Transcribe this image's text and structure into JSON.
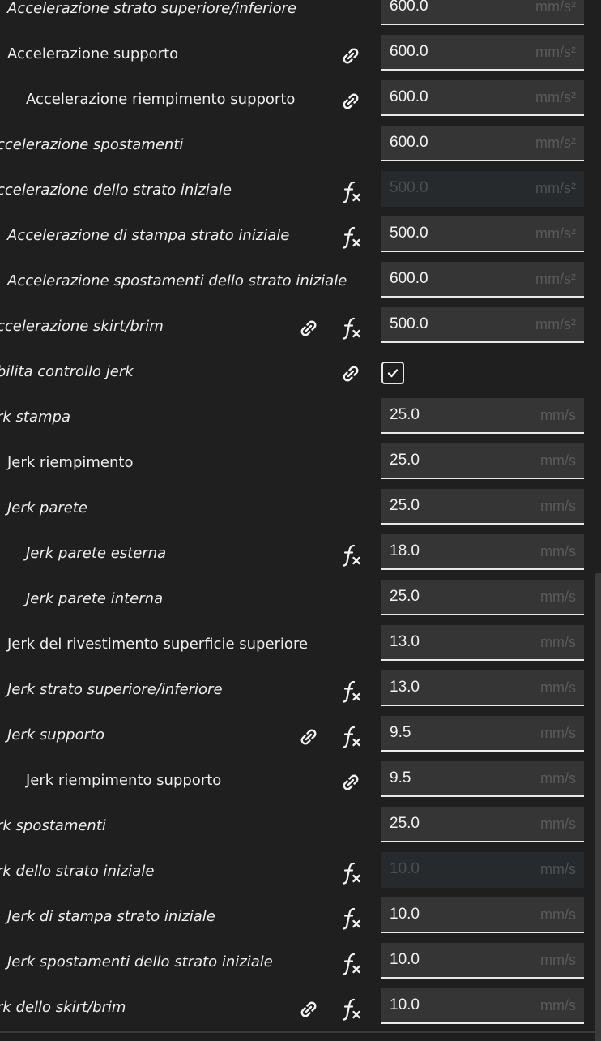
{
  "settings": [
    {
      "label": "Accelerazione strato superiore/inferiore",
      "italic": true,
      "indent": 2,
      "link": false,
      "link_col2": false,
      "fx": false,
      "value": "600.0",
      "unit": "mm/s²",
      "disabled": false
    },
    {
      "label": "Accelerazione supporto",
      "italic": false,
      "indent": 2,
      "link": true,
      "link_col2": false,
      "fx": false,
      "value": "600.0",
      "unit": "mm/s²",
      "disabled": false
    },
    {
      "label": "Accelerazione riempimento supporto",
      "italic": false,
      "indent": 3,
      "link": true,
      "link_col2": false,
      "fx": false,
      "value": "600.0",
      "unit": "mm/s²",
      "disabled": false
    },
    {
      "label": "ccelerazione spostamenti",
      "italic": true,
      "indent": 1,
      "link": false,
      "link_col2": false,
      "fx": false,
      "value": "600.0",
      "unit": "mm/s²",
      "disabled": false
    },
    {
      "label": "ccelerazione dello strato iniziale",
      "italic": true,
      "indent": 1,
      "link": false,
      "link_col2": false,
      "fx": true,
      "value": "500.0",
      "unit": "mm/s²",
      "disabled": true
    },
    {
      "label": "Accelerazione di stampa strato iniziale",
      "italic": true,
      "indent": 2,
      "link": false,
      "link_col2": false,
      "fx": true,
      "value": "500.0",
      "unit": "mm/s²",
      "disabled": false
    },
    {
      "label": "Accelerazione spostamenti dello strato iniziale",
      "italic": true,
      "indent": 2,
      "link": false,
      "link_col2": false,
      "fx": false,
      "value": "600.0",
      "unit": "mm/s²",
      "disabled": false
    },
    {
      "label": "ccelerazione skirt/brim",
      "italic": true,
      "indent": 1,
      "link": false,
      "link_col2": true,
      "fx": true,
      "value": "500.0",
      "unit": "mm/s²",
      "disabled": false
    },
    {
      "label": "bilita controllo jerk",
      "italic": true,
      "indent": 1,
      "link": true,
      "link_col2": false,
      "fx": false,
      "checkbox": true,
      "checked": true
    },
    {
      "label": "rk stampa",
      "italic": true,
      "indent": 1,
      "link": false,
      "link_col2": false,
      "fx": false,
      "value": "25.0",
      "unit": "mm/s",
      "disabled": false
    },
    {
      "label": "Jerk riempimento",
      "italic": false,
      "indent": 2,
      "link": false,
      "link_col2": false,
      "fx": false,
      "value": "25.0",
      "unit": "mm/s",
      "disabled": false
    },
    {
      "label": "Jerk parete",
      "italic": true,
      "indent": 2,
      "link": false,
      "link_col2": false,
      "fx": false,
      "value": "25.0",
      "unit": "mm/s",
      "disabled": false
    },
    {
      "label": "Jerk parete esterna",
      "italic": true,
      "indent": 3,
      "link": false,
      "link_col2": false,
      "fx": true,
      "value": "18.0",
      "unit": "mm/s",
      "disabled": false
    },
    {
      "label": "Jerk parete interna",
      "italic": true,
      "indent": 3,
      "link": false,
      "link_col2": false,
      "fx": false,
      "value": "25.0",
      "unit": "mm/s",
      "disabled": false
    },
    {
      "label": "Jerk del rivestimento superficie superiore",
      "italic": false,
      "indent": 2,
      "link": false,
      "link_col2": false,
      "fx": false,
      "value": "13.0",
      "unit": "mm/s",
      "disabled": false
    },
    {
      "label": "Jerk strato superiore/inferiore",
      "italic": true,
      "indent": 2,
      "link": false,
      "link_col2": false,
      "fx": true,
      "value": "13.0",
      "unit": "mm/s",
      "disabled": false
    },
    {
      "label": "Jerk supporto",
      "italic": true,
      "indent": 2,
      "link": false,
      "link_col2": true,
      "fx": true,
      "value": "9.5",
      "unit": "mm/s",
      "disabled": false
    },
    {
      "label": "Jerk riempimento supporto",
      "italic": false,
      "indent": 3,
      "link": true,
      "link_col2": false,
      "fx": false,
      "value": "9.5",
      "unit": "mm/s",
      "disabled": false
    },
    {
      "label": "rk spostamenti",
      "italic": true,
      "indent": 1,
      "link": false,
      "link_col2": false,
      "fx": false,
      "value": "25.0",
      "unit": "mm/s",
      "disabled": false
    },
    {
      "label": "rk dello strato iniziale",
      "italic": true,
      "indent": 1,
      "link": false,
      "link_col2": false,
      "fx": true,
      "value": "10.0",
      "unit": "mm/s",
      "disabled": true
    },
    {
      "label": "Jerk di stampa strato iniziale",
      "italic": true,
      "indent": 2,
      "link": false,
      "link_col2": false,
      "fx": true,
      "value": "10.0",
      "unit": "mm/s",
      "disabled": false
    },
    {
      "label": "Jerk spostamenti dello strato iniziale",
      "italic": true,
      "indent": 2,
      "link": false,
      "link_col2": false,
      "fx": true,
      "value": "10.0",
      "unit": "mm/s",
      "disabled": false
    },
    {
      "label": "rk dello skirt/brim",
      "italic": true,
      "indent": 1,
      "link": false,
      "link_col2": true,
      "fx": true,
      "value": "10.0",
      "unit": "mm/s",
      "disabled": false
    }
  ],
  "icons": {
    "link": "link-icon",
    "fx": "function-icon",
    "check": "checkmark-icon"
  },
  "colors": {
    "background": "#1f1f1f",
    "field": "#353535",
    "field_disabled": "#262a2d",
    "text": "#eeeeee",
    "unit": "#5a5a5a"
  }
}
